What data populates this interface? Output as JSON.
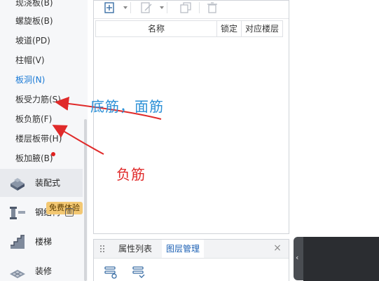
{
  "tree_items": [
    {
      "label": "现浇板(B)",
      "active": false
    },
    {
      "label": "螺旋板(B)",
      "active": false
    },
    {
      "label": "坡道(PD)",
      "active": false
    },
    {
      "label": "柱帽(V)",
      "active": false
    },
    {
      "label": "板洞(N)",
      "active": true
    },
    {
      "label": "板受力筋(S)",
      "active": false
    },
    {
      "label": "板负筋(F)",
      "active": false
    },
    {
      "label": "楼层板带(H)",
      "active": false
    },
    {
      "label": "板加腋(B)",
      "active": false
    }
  ],
  "categories": [
    {
      "label": "装配式",
      "icon": "prefab-icon"
    },
    {
      "label": "钢结构",
      "icon": "steel-structure-icon"
    },
    {
      "label": "楼梯",
      "icon": "stairs-icon"
    },
    {
      "label": "装修",
      "icon": "decoration-icon"
    }
  ],
  "trial_badge": "免费体验",
  "table": {
    "headers": [
      "名称",
      "锁定",
      "对应楼层"
    ]
  },
  "panel_tabs": [
    {
      "label": "属性列表",
      "active": false
    },
    {
      "label": "图层管理",
      "active": true
    }
  ],
  "close_symbol": "×",
  "collapse_symbol": "‹",
  "annotations": {
    "top": "底筋，面筋",
    "bottom": "负筋"
  },
  "colors": {
    "accent_blue": "#1a7ad6",
    "annotation_blue": "#2a8fd6",
    "annotation_red": "#e02a2a",
    "badge": "#f3c873"
  }
}
